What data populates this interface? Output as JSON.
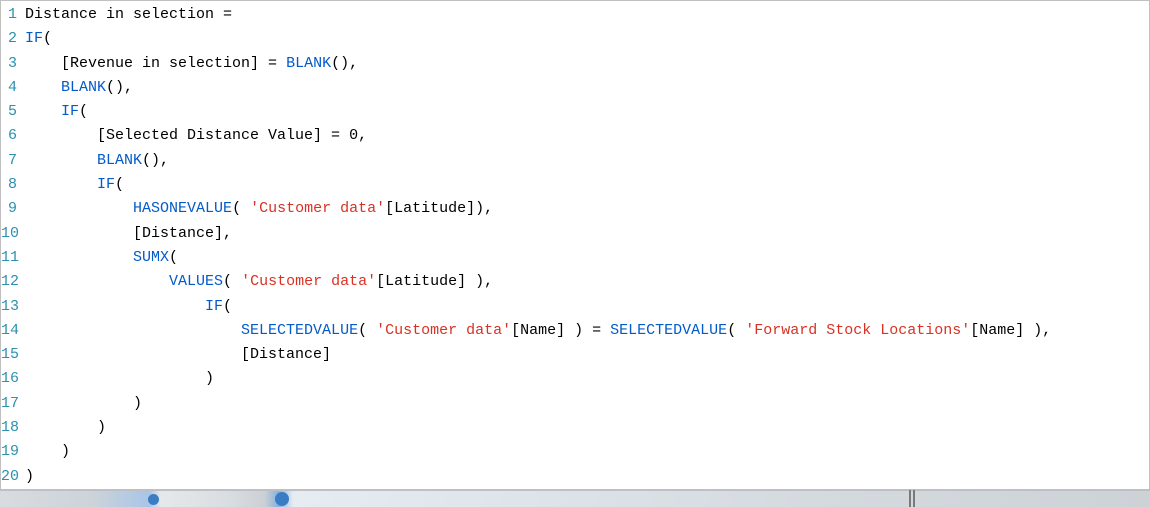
{
  "editor": {
    "lineNumbers": [
      "1",
      "2",
      "3",
      "4",
      "5",
      "6",
      "7",
      "8",
      "9",
      "10",
      "11",
      "12",
      "13",
      "14",
      "15",
      "16",
      "17",
      "18",
      "19",
      "20"
    ],
    "lines": [
      {
        "indent": "",
        "tokens": [
          {
            "t": "plain",
            "v": "Distance in selection ="
          }
        ]
      },
      {
        "indent": "",
        "tokens": [
          {
            "t": "kw",
            "v": "IF"
          },
          {
            "t": "plain",
            "v": "("
          }
        ]
      },
      {
        "indent": "    ",
        "tokens": [
          {
            "t": "plain",
            "v": "[Revenue in selection] = "
          },
          {
            "t": "fn",
            "v": "BLANK"
          },
          {
            "t": "plain",
            "v": "(),"
          }
        ]
      },
      {
        "indent": "    ",
        "tokens": [
          {
            "t": "fn",
            "v": "BLANK"
          },
          {
            "t": "plain",
            "v": "(),"
          }
        ]
      },
      {
        "indent": "    ",
        "tokens": [
          {
            "t": "kw",
            "v": "IF"
          },
          {
            "t": "plain",
            "v": "("
          }
        ]
      },
      {
        "indent": "        ",
        "tokens": [
          {
            "t": "plain",
            "v": "[Selected Distance Value] = "
          },
          {
            "t": "num",
            "v": "0"
          },
          {
            "t": "plain",
            "v": ","
          }
        ]
      },
      {
        "indent": "        ",
        "tokens": [
          {
            "t": "fn",
            "v": "BLANK"
          },
          {
            "t": "plain",
            "v": "(),"
          }
        ]
      },
      {
        "indent": "        ",
        "tokens": [
          {
            "t": "kw",
            "v": "IF"
          },
          {
            "t": "plain",
            "v": "("
          }
        ]
      },
      {
        "indent": "            ",
        "tokens": [
          {
            "t": "fn",
            "v": "HASONEVALUE"
          },
          {
            "t": "plain",
            "v": "( "
          },
          {
            "t": "str",
            "v": "'Customer data'"
          },
          {
            "t": "plain",
            "v": "[Latitude]),"
          }
        ]
      },
      {
        "indent": "            ",
        "tokens": [
          {
            "t": "plain",
            "v": "[Distance],"
          }
        ]
      },
      {
        "indent": "            ",
        "tokens": [
          {
            "t": "fn",
            "v": "SUMX"
          },
          {
            "t": "plain",
            "v": "("
          }
        ]
      },
      {
        "indent": "                ",
        "tokens": [
          {
            "t": "fn",
            "v": "VALUES"
          },
          {
            "t": "plain",
            "v": "( "
          },
          {
            "t": "str",
            "v": "'Customer data'"
          },
          {
            "t": "plain",
            "v": "[Latitude] ),"
          }
        ]
      },
      {
        "indent": "                    ",
        "tokens": [
          {
            "t": "kw",
            "v": "IF"
          },
          {
            "t": "plain",
            "v": "("
          }
        ]
      },
      {
        "indent": "                        ",
        "tokens": [
          {
            "t": "fn",
            "v": "SELECTEDVALUE"
          },
          {
            "t": "plain",
            "v": "( "
          },
          {
            "t": "str",
            "v": "'Customer data'"
          },
          {
            "t": "plain",
            "v": "[Name] ) = "
          },
          {
            "t": "fn",
            "v": "SELECTEDVALUE"
          },
          {
            "t": "plain",
            "v": "( "
          },
          {
            "t": "str",
            "v": "'Forward Stock Locations'"
          },
          {
            "t": "plain",
            "v": "[Name] ),"
          }
        ]
      },
      {
        "indent": "                        ",
        "tokens": [
          {
            "t": "plain",
            "v": "[Distance]"
          }
        ]
      },
      {
        "indent": "                    ",
        "tokens": [
          {
            "t": "plain",
            "v": ")"
          }
        ]
      },
      {
        "indent": "            ",
        "tokens": [
          {
            "t": "plain",
            "v": ")"
          }
        ]
      },
      {
        "indent": "        ",
        "tokens": [
          {
            "t": "plain",
            "v": ")"
          }
        ]
      },
      {
        "indent": "    ",
        "tokens": [
          {
            "t": "plain",
            "v": ")"
          }
        ]
      },
      {
        "indent": "",
        "tokens": [
          {
            "t": "plain",
            "v": ")"
          }
        ]
      }
    ]
  }
}
